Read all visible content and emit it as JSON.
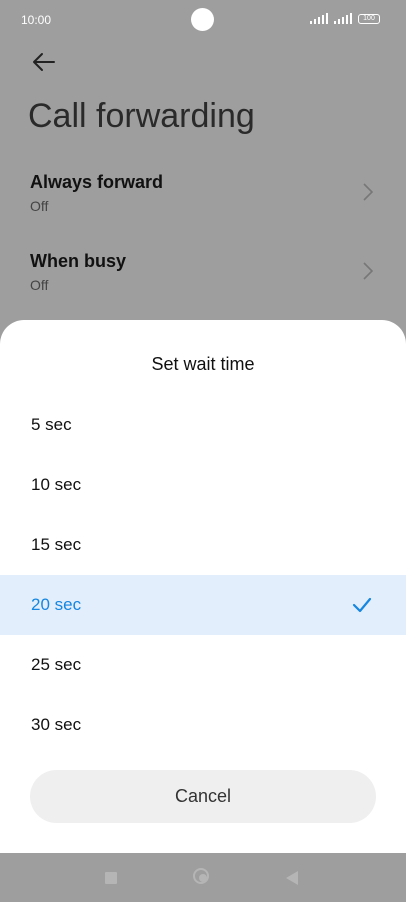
{
  "status_bar": {
    "time": "10:00",
    "battery": "100"
  },
  "page": {
    "title": "Call forwarding",
    "settings": [
      {
        "title": "Always forward",
        "value": "Off"
      },
      {
        "title": "When busy",
        "value": "Off"
      }
    ]
  },
  "sheet": {
    "title": "Set wait time",
    "options": [
      {
        "label": "5 sec"
      },
      {
        "label": "10 sec"
      },
      {
        "label": "15 sec"
      },
      {
        "label": "20 sec",
        "selected": true
      },
      {
        "label": "25 sec"
      },
      {
        "label": "30 sec"
      }
    ],
    "cancel_label": "Cancel"
  },
  "colors": {
    "accent": "#1686e0",
    "selected_bg": "#e2eefc",
    "dim_overlay": "#9e9e9e"
  },
  "icons": {
    "back": "arrow-left-icon",
    "chevron": "chevron-right-icon",
    "check": "checkmark-icon",
    "nav_recents": "square-icon",
    "nav_home": "circle-icon",
    "nav_back": "triangle-back-icon"
  }
}
